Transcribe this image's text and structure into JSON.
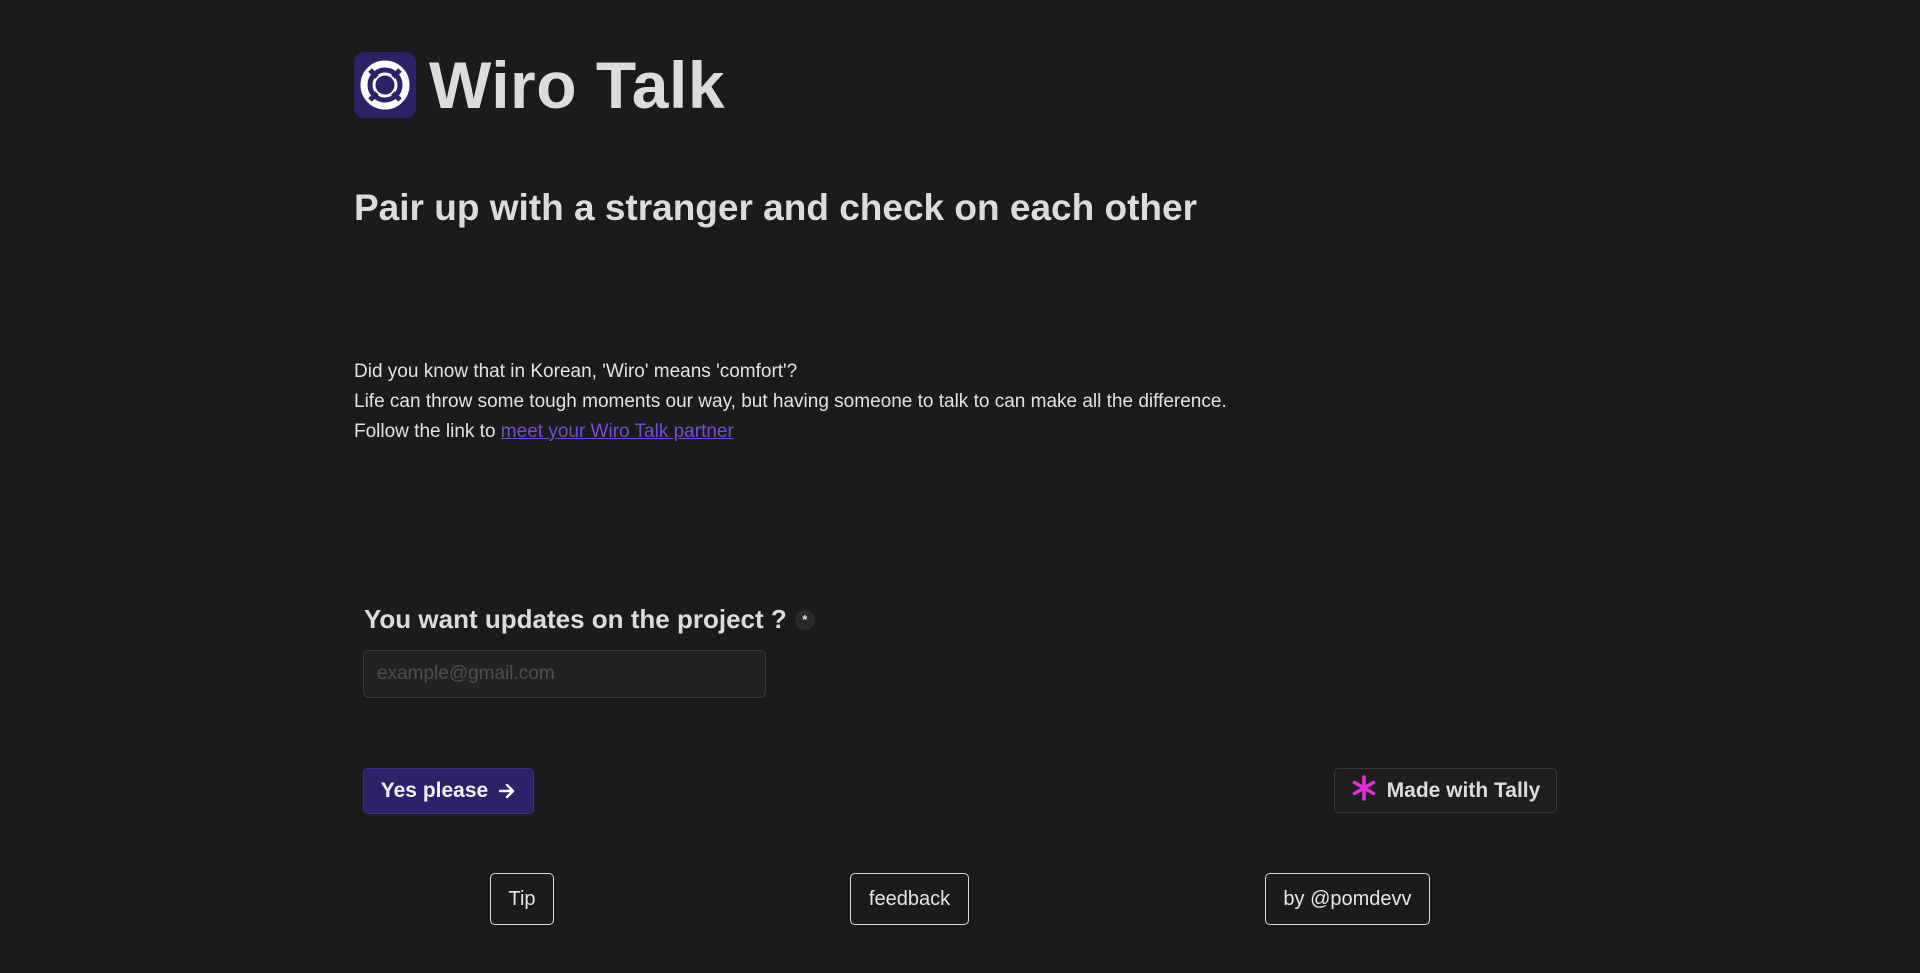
{
  "brand": {
    "title": "Wiro Talk",
    "logo_icon": "lifebuoy-icon",
    "logo_bg": "#2d2168"
  },
  "headline": "Pair up with a stranger and check on each other",
  "intro": {
    "line1": "Did you know that in Korean, 'Wiro' means 'comfort'?",
    "line2": "Life can throw some tough moments our way, but having someone to talk to can make all the difference.",
    "line3_prefix": "Follow the link to",
    "link_text": "meet your Wiro Talk partner",
    "link_color": "#6f4fd8"
  },
  "form": {
    "question": "You want updates on the project ?",
    "required_mark": "*",
    "email_placeholder": "example@gmail.com",
    "email_value": "",
    "submit_label": "Yes please",
    "submit_icon": "arrow-right-icon"
  },
  "tally": {
    "label": "Made with Tally",
    "icon": "asterisk-icon",
    "icon_color": "#e62ed6"
  },
  "footer": {
    "tip_label": "Tip",
    "feedback_label": "feedback",
    "author_label": "by @pomdevv"
  },
  "colors": {
    "background": "#1b1b1b",
    "accent": "#2d2168",
    "text": "#dcdcdc"
  }
}
